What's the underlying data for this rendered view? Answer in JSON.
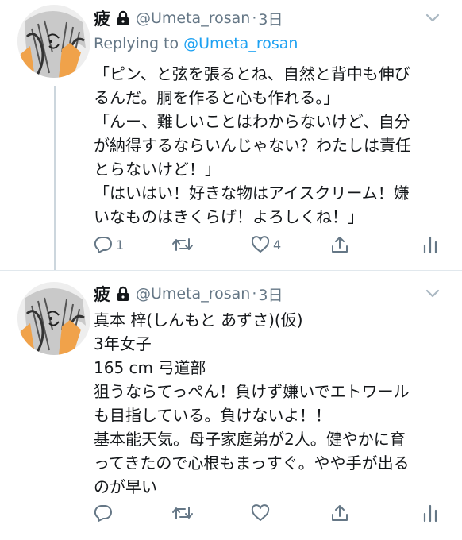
{
  "tweets": [
    {
      "name": "疲",
      "handle": "@Umeta_rosan",
      "dot": "·",
      "time": "3日",
      "reply_label": "Replying to",
      "reply_to": "@Umeta_rosan",
      "lines": [
        "「ピン、と弦を張るとね、自然と背中も伸び",
        "るんだ。胴を作ると心も作れる。」",
        "「んー、難しいことはわからないけど、自分",
        "が納得するならいんじゃない？わたしは責任",
        "とらないけど！」",
        "「はいはい！好きな物はアイスクリーム！嫌",
        "いなものはきくらげ！よろしくね！」"
      ],
      "actions": {
        "reply_count": "1",
        "retweet_count": "",
        "like_count": "4"
      }
    },
    {
      "name": "疲",
      "handle": "@Umeta_rosan",
      "dot": "·",
      "time": "3日",
      "lines": [
        "真本 梓(しんもと あずさ)(仮)",
        "3年女子",
        "165 cm 弓道部",
        "狙うならてっぺん！負けず嫌いでエトワール",
        "も目指している。負けないよ！！",
        "基本能天気。母子家庭弟が2人。健やかに育",
        "ってきたので心根もまっすぐ。やや手が出る",
        "のが早い"
      ],
      "actions": {
        "reply_count": "",
        "retweet_count": "",
        "like_count": ""
      }
    }
  ],
  "colors": {
    "text": "#14171a",
    "muted": "#657786",
    "link": "#1da1f2",
    "divider": "#e1e8ed",
    "thread": "#ccd6dd"
  },
  "icons": [
    "lock-icon",
    "chevron-down-icon",
    "reply-icon",
    "retweet-icon",
    "like-icon",
    "share-icon",
    "analytics-icon"
  ]
}
